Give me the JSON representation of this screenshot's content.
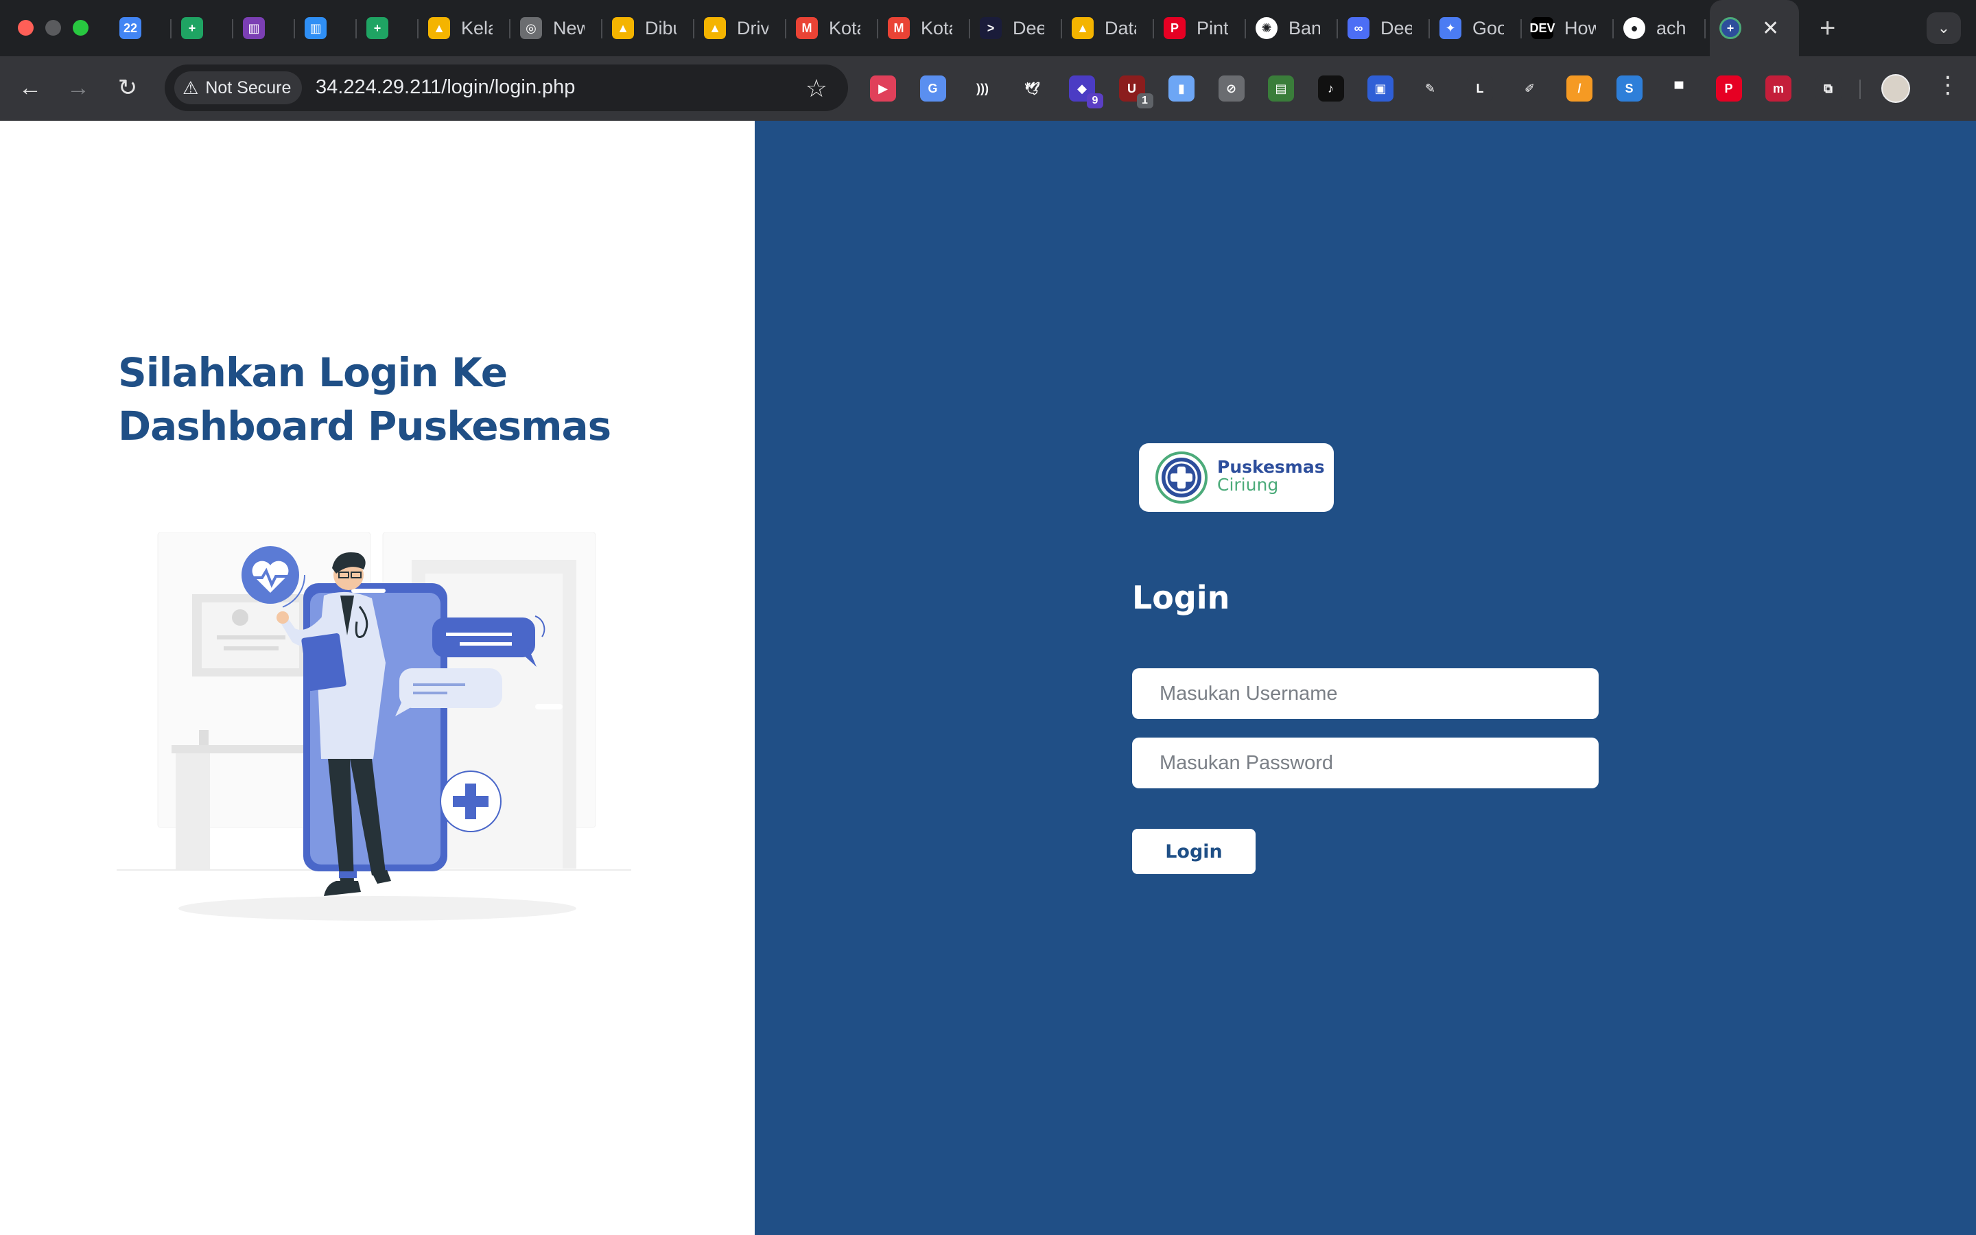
{
  "browser": {
    "tabs": [
      {
        "title": "",
        "icon": "google-calendar-icon",
        "color": "#4285f4",
        "glyph": "22"
      },
      {
        "title": "",
        "icon": "google-sheets-icon",
        "color": "#1fa463",
        "glyph": "+"
      },
      {
        "title": "",
        "icon": "trello-purple-icon",
        "color": "#7b3fb4",
        "glyph": "▥"
      },
      {
        "title": "",
        "icon": "trello-icon",
        "color": "#2f8ff5",
        "glyph": "▥"
      },
      {
        "title": "",
        "icon": "google-sheets-icon",
        "color": "#1fa463",
        "glyph": "+"
      },
      {
        "title": "Kela",
        "icon": "google-drive-icon",
        "color": "#f4b400",
        "glyph": "▲"
      },
      {
        "title": "New",
        "icon": "chrome-icon",
        "color": "#6b6d70",
        "glyph": "◎"
      },
      {
        "title": "Dibu",
        "icon": "google-drive-icon",
        "color": "#f4b400",
        "glyph": "▲"
      },
      {
        "title": "Driv",
        "icon": "google-drive-icon",
        "color": "#f4b400",
        "glyph": "▲"
      },
      {
        "title": "Kota",
        "icon": "gmail-icon",
        "color": "#ea4335",
        "glyph": "M"
      },
      {
        "title": "Kota",
        "icon": "gmail-icon",
        "color": "#ea4335",
        "glyph": "M"
      },
      {
        "title": "Dee",
        "icon": "deepnote-icon",
        "color": "#1a1c3a",
        "glyph": ">"
      },
      {
        "title": "Data",
        "icon": "google-drive-icon",
        "color": "#f4b400",
        "glyph": "▲"
      },
      {
        "title": "Pint",
        "icon": "pinterest-icon",
        "color": "#e60023",
        "glyph": "P"
      },
      {
        "title": "Ban",
        "icon": "openai-icon",
        "color": "#ffffff",
        "glyph": "✺"
      },
      {
        "title": "Dee",
        "icon": "deepl-icon",
        "color": "#4c6ef5",
        "glyph": "∞"
      },
      {
        "title": "Goo",
        "icon": "gemini-icon",
        "color": "#4b7cf3",
        "glyph": "✦"
      },
      {
        "title": "How",
        "icon": "dev-icon",
        "color": "#000000",
        "glyph": "DEV"
      },
      {
        "title": "ach",
        "icon": "github-icon",
        "color": "#ffffff",
        "glyph": "●"
      }
    ],
    "active_tab": {
      "icon": "puskesmas-tab-icon",
      "close": "✕"
    },
    "new_tab": "+",
    "security_label": "Not Secure",
    "url": "34.224.29.211/login/login.php",
    "extensions": [
      {
        "icon": "pocket-icon",
        "color": "#e0405a",
        "glyph": "▶"
      },
      {
        "icon": "google-translate-icon",
        "color": "#5a8ff0",
        "glyph": "G"
      },
      {
        "icon": "wave-icon",
        "color": "#35363a",
        "glyph": ")))"
      },
      {
        "icon": "bird-icon",
        "color": "#35363a",
        "glyph": "🕊"
      },
      {
        "icon": "cube-icon",
        "color": "#4b3cc4",
        "glyph": "◆",
        "badge": "9"
      },
      {
        "icon": "ublock-icon",
        "color": "#8b1d1d",
        "glyph": "U",
        "badge": "1"
      },
      {
        "icon": "clipboard-icon",
        "color": "#6da6f5",
        "glyph": "▮"
      },
      {
        "icon": "block-icon",
        "color": "#6a6c70",
        "glyph": "⊘"
      },
      {
        "icon": "calendar-ext-icon",
        "color": "#3a7d3a",
        "glyph": "▤"
      },
      {
        "icon": "tiktok-icon",
        "color": "#111111",
        "glyph": "♪"
      },
      {
        "icon": "picker-icon",
        "color": "#2f5fd6",
        "glyph": "▣"
      },
      {
        "icon": "eyedropper-icon",
        "color": "#35363a",
        "glyph": "✎"
      },
      {
        "icon": "l-icon",
        "color": "#35363a",
        "glyph": "L"
      },
      {
        "icon": "syringe-icon",
        "color": "#35363a",
        "glyph": "✐"
      },
      {
        "icon": "pencil-icon",
        "color": "#f59a23",
        "glyph": "/"
      },
      {
        "icon": "s-icon",
        "color": "#2e7fd9",
        "glyph": "S"
      },
      {
        "icon": "print-icon",
        "color": "#35363a",
        "glyph": "▀"
      },
      {
        "icon": "pinterest-ext-icon",
        "color": "#e60023",
        "glyph": "P"
      },
      {
        "icon": "mendeley-icon",
        "color": "#c41e3a",
        "glyph": "m"
      },
      {
        "icon": "puzzle-icon",
        "color": "#35363a",
        "glyph": "⧉"
      }
    ]
  },
  "page": {
    "headline_line1": "Silahkan Login Ke",
    "headline_line2": "Dashboard Puskesmas",
    "logo": {
      "name": "Puskesmas",
      "sub": "Ciriung"
    },
    "login_title": "Login",
    "username_placeholder": "Masukan Username",
    "password_placeholder": "Masukan Password",
    "login_button": "Login",
    "colors": {
      "panel": "#204f86",
      "heading": "#1f4f86",
      "accent_green": "#4cab7a",
      "illustration_blue": "#5b7bd5"
    }
  }
}
